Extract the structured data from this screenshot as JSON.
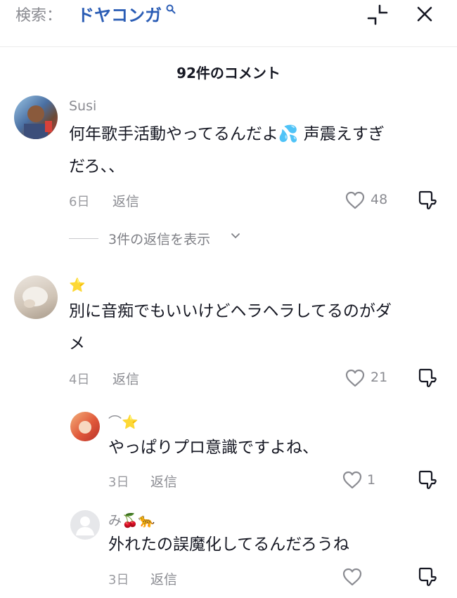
{
  "search": {
    "label": "検索：",
    "query": "ドヤコンガ"
  },
  "header": {
    "title": "92件のコメント"
  },
  "comments": [
    {
      "username": "Susi",
      "text_line1": "何年歌手活動やってるんだよ💦 声震えすぎ",
      "text_line2": "だろ、、",
      "time": "6日",
      "reply_label": "返信",
      "likes": "48",
      "view_replies": "3件の返信を表示"
    },
    {
      "username": "⭐",
      "text_line1": "別に音痴でもいいけどヘラヘラしてるのがダ",
      "text_line2": "メ",
      "time": "4日",
      "reply_label": "返信",
      "likes": "21"
    },
    {
      "username": "⌒⭐",
      "text_line1": "やっぱりプロ意識ですよね、",
      "time": "3日",
      "reply_label": "返信",
      "likes": "1"
    },
    {
      "username": "み🍒🐆",
      "text_line1": "外れたの誤魔化してるんだろうね",
      "time": "3日",
      "reply_label": "返信",
      "likes": ""
    }
  ],
  "colors": {
    "accent": "#2b5db5",
    "muted": "#8a8b91",
    "text": "#161823"
  }
}
